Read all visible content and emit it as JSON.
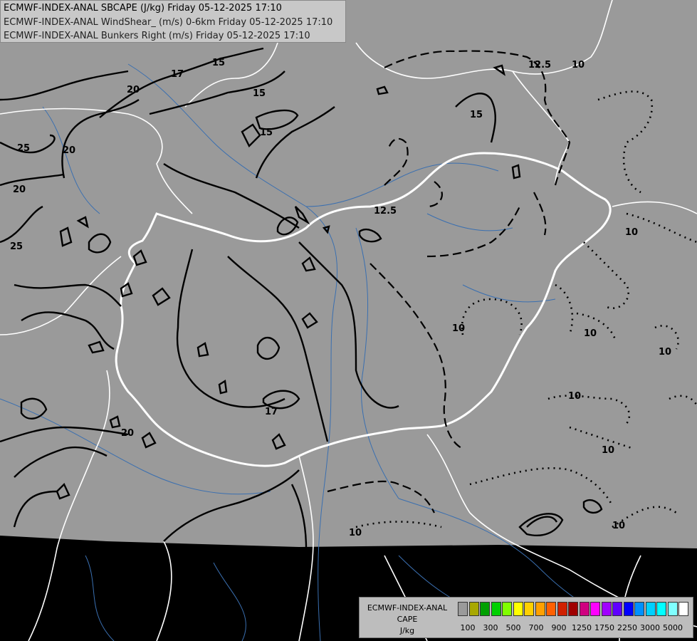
{
  "header": {
    "line1": "ECMWF-INDEX-ANAL SBCAPE (J/kg) Friday 05-12-2025 17:10",
    "line2": "ECMWF-INDEX-ANAL WindShear_ (m/s) 0-6km Friday 05-12-2025 17:10",
    "line3": "ECMWF-INDEX-ANAL Bunkers Right (m/s) Friday 05-12-2025 17:10"
  },
  "legend": {
    "title1": "ECMWF-INDEX-ANAL",
    "title2": "CAPE",
    "unit": "J/kg",
    "swatch_colors": [
      "#9a9a9a",
      "#a8a800",
      "#00a000",
      "#00d000",
      "#80ff00",
      "#ffff00",
      "#ffd000",
      "#ffa000",
      "#ff6000",
      "#d02000",
      "#a00000",
      "#d00080",
      "#ff00ff",
      "#a000ff",
      "#6000ff",
      "#0000ff",
      "#0090ff",
      "#00d0ff",
      "#00ffff",
      "#80ffff",
      "#ffffff"
    ],
    "ticks": [
      "100",
      "300",
      "500",
      "700",
      "900",
      "1250",
      "1750",
      "2250",
      "3000",
      "5000"
    ]
  },
  "colors": {
    "map_background": "#9a9a9a",
    "outside_domain": "#000000",
    "borders": "#ffffff",
    "rivers": "#3a6fb0",
    "contours": "#000000"
  },
  "contour_labels": [
    "17",
    "15",
    "20",
    "25",
    "20",
    "15",
    "15",
    "25",
    "20",
    "17",
    "20",
    "12.5",
    "12.5",
    "15",
    "10",
    "10",
    "10",
    "10",
    "10",
    "10",
    "10",
    "10",
    "10"
  ]
}
